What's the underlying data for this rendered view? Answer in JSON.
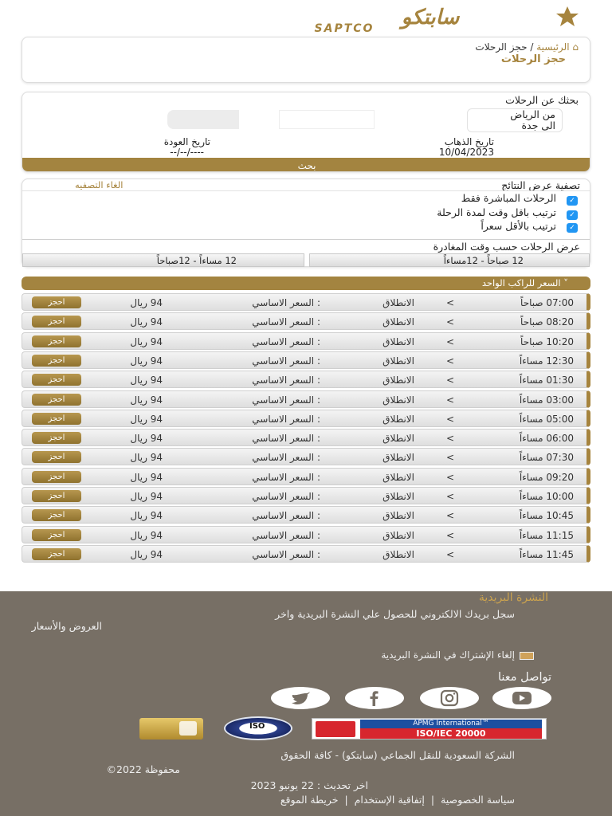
{
  "brand": {
    "logo_ar": "سابتكو",
    "logo_en": "SAPTCO"
  },
  "breadcrumb": {
    "home": "الرئيسية",
    "sep": "/",
    "current": "حجز الرحلات"
  },
  "page_title": "حجز الرحلات",
  "search": {
    "heading": "بحثك عن الرحلات",
    "from": "من الرياض",
    "to": "الى جدة",
    "depart_label": "تاريخ الذهاب",
    "depart_value": "10/04/2023",
    "return_label": "تاريخ العودة",
    "return_value": "----/--/--",
    "button": "بحث"
  },
  "filter": {
    "title": "تصفية عرض النتائج",
    "clear": "الغاء التصفيه",
    "options": [
      "الرحلات المباشرة فقط",
      "ترتيب باقل وقت لمدة الرحلة",
      "ترتيب بالأقل سعراً"
    ],
    "check": "✓",
    "time_title": "عرض الرحلات حسب وقت المغادرة",
    "time_a": "12 صباحاً - 12مساءاً",
    "time_b": "12 مساءاً - 12صباحاً"
  },
  "price_header": "˅ السعر للراكب الواحد",
  "trip_labels": {
    "arrow": ">",
    "depart": "الانطلاق",
    "base": ": السعر الاساسي",
    "book": "احجز"
  },
  "trips": [
    {
      "time": "07:00 صباحاً",
      "price": "94 ريال"
    },
    {
      "time": "08:20 صباحاً",
      "price": "94 ريال"
    },
    {
      "time": "10:20 صباحاً",
      "price": "94 ريال"
    },
    {
      "time": "12:30 مساءاً",
      "price": "94 ريال"
    },
    {
      "time": "01:30 مساءاً",
      "price": "94 ريال"
    },
    {
      "time": "03:00 مساءاً",
      "price": "94 ريال"
    },
    {
      "time": "05:00 مساءاً",
      "price": "94 ريال"
    },
    {
      "time": "06:00 مساءاً",
      "price": "94 ريال"
    },
    {
      "time": "07:30 مساءاً",
      "price": "94 ريال"
    },
    {
      "time": "09:20 مساءاً",
      "price": "94 ريال"
    },
    {
      "time": "10:00 مساءاً",
      "price": "94 ريال"
    },
    {
      "time": "10:45 مساءاً",
      "price": "94 ريال"
    },
    {
      "time": "11:15 مساءاً",
      "price": "94 ريال"
    },
    {
      "time": "11:45 مساءاً",
      "price": "94 ريال"
    }
  ],
  "footer": {
    "newsletter_title": "النشرة البريدية",
    "newsletter_text1": "سجل بريدك الالكتروني للحصول علي النشرة البريدية واخر",
    "newsletter_text2": "العروض والأسعار",
    "unsubscribe": "إلغاء الإشتراك في النشرة البريدية",
    "contact": "تواصل معنا",
    "cert_text": "APMG International™",
    "cert_iso": "ISO/IEC 20000",
    "iso_badge": "ISO",
    "copyright1": "الشركة السعودية للنقل الجماعي (سابتكو) - كافة الحقوق",
    "copyright2": "محفوظة 2022©",
    "updated": "اخر تحديث : 22 يونيو 2023",
    "links": [
      "سياسة الخصوصية",
      "إتفاقية الإستخدام",
      "خريطة الموقع"
    ],
    "link_sep": "|"
  },
  "colors": {
    "gold": "#a38440",
    "footer_bg": "#776f65"
  }
}
